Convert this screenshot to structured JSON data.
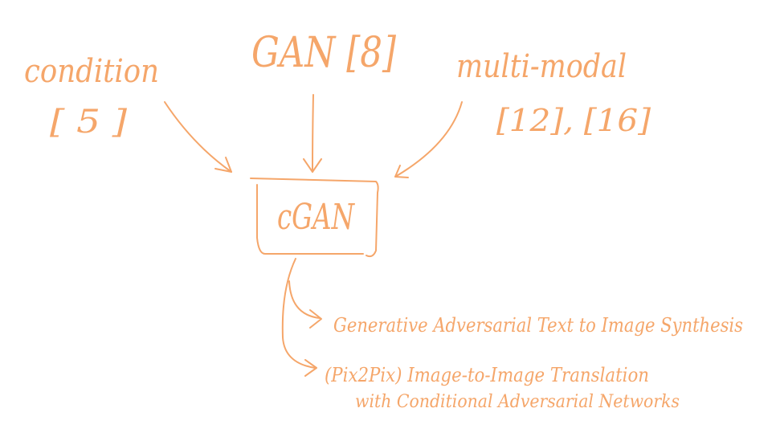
{
  "ink_color": "#F5A66A",
  "nodes": {
    "condition": {
      "line1": "condition",
      "line2": "[ 5 ]"
    },
    "gan": {
      "label": "GAN [8]"
    },
    "multimodal": {
      "line1": "multi-modal",
      "line2": "[12], [16]"
    },
    "cgan": {
      "label": "cGAN"
    }
  },
  "outputs": {
    "first": {
      "label": "Generative Adversarial Text to Image Synthesis"
    },
    "second": {
      "line1": "(Pix2Pix) Image-to-Image Translation",
      "line2": "with Conditional Adversarial Networks"
    }
  }
}
